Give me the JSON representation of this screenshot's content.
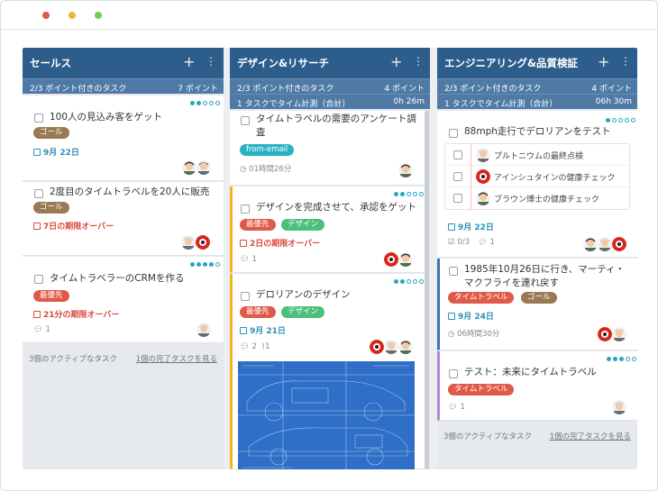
{
  "columns": [
    {
      "title": "セールス",
      "points_label": "2/3 ポイント付きのタスク",
      "points_value": "7 ポイント",
      "cards": [
        {
          "title": "100人の見込み客をゲット",
          "tag": "ゴール",
          "due": "9月 22日"
        },
        {
          "title": "2度目のタイムトラベルを20人に販売",
          "tag": "ゴール",
          "due": "7日の期限オーバー"
        },
        {
          "title": "タイムトラベラーのCRMを作る",
          "tag": "最優先",
          "due": "21分の期限オーバー",
          "comments": "1"
        }
      ],
      "footer_left": "3個のアクティブなタスク",
      "footer_right": "1個の完了タスクを見る"
    },
    {
      "title": "デザイン&リサーチ",
      "points_label": "2/3 ポイント付きのタスク",
      "points_value": "4 ポイント",
      "time_label": "1 タスクでタイム計測（合計）",
      "time_value": "0h 26m",
      "cards": [
        {
          "title": "タイムトラベルの需要のアンケート調査",
          "tag": "from-email",
          "time": "01時間26分"
        },
        {
          "title": "デザインを完成させて、承認をゲット",
          "tags": [
            "最優先",
            "デザイン"
          ],
          "due": "2日の期限オーバー",
          "comments": "1"
        },
        {
          "title": "デロリアンのデザイン",
          "tags": [
            "最優先",
            "デザイン"
          ],
          "due": "9月 21日",
          "comments": "2",
          "attachments": "1"
        }
      ]
    },
    {
      "title": "エンジニアリング&品質検証",
      "points_label": "2/3 ポイント付きのタスク",
      "points_value": "4 ポイント",
      "time_label": "1 タスクでタイム計測（合計）",
      "time_value": "06h 30m",
      "cards": [
        {
          "title": "88mph走行でデロリアンをテスト",
          "subtasks": [
            "プルトニウムの最終点検",
            "アインシュタインの健康チェック",
            "ブラウン博士の健康チェック"
          ],
          "due": "9月 22日",
          "checklist": "0/3",
          "comments": "1"
        },
        {
          "title": "1985年10月26日に行き、マーティ・マクフライを連れ戻す",
          "tags": [
            "タイムトラベル",
            "ゴール"
          ],
          "due": "9月 24日",
          "time": "06時間30分"
        },
        {
          "title": "テスト：未来にタイムトラベル",
          "tag": "タイムトラベル",
          "comments": "1"
        }
      ],
      "footer_left": "3個のアクティブなタスク",
      "footer_right": "1個の完了タスクを見る"
    }
  ],
  "icons": {
    "add": "plus-icon",
    "more": "more-vertical-icon",
    "calendar": "calendar-icon",
    "comment": "comment-icon",
    "clock": "clock-icon",
    "attachment": "paperclip-icon",
    "checklist": "checklist-icon"
  },
  "colors": {
    "header": "#2d5d8a",
    "subheader": "#4f7aa5",
    "goal": "#9a7a55",
    "priority": "#e05a4a",
    "design": "#4cbf7c",
    "email": "#29b3c2",
    "due_blue": "#2a8fbd",
    "due_red": "#d9493a",
    "accent_yellow": "#f5b51a",
    "accent_purple": "#b487d8"
  }
}
